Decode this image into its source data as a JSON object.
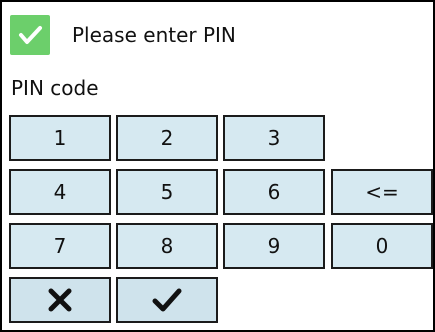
{
  "header": {
    "title": "Please enter PIN",
    "icon": "check-icon",
    "icon_color": "#6ccf6b"
  },
  "form": {
    "label": "PIN code"
  },
  "keypad": {
    "key_color": "#d6e9f1",
    "keys": [
      {
        "label": "1"
      },
      {
        "label": "2"
      },
      {
        "label": "3"
      },
      {
        "label": "4"
      },
      {
        "label": "5"
      },
      {
        "label": "6"
      },
      {
        "label": "<="
      },
      {
        "label": "7"
      },
      {
        "label": "8"
      },
      {
        "label": "9"
      },
      {
        "label": "0"
      }
    ],
    "cancel_icon": "close-icon",
    "confirm_icon": "check-icon"
  }
}
